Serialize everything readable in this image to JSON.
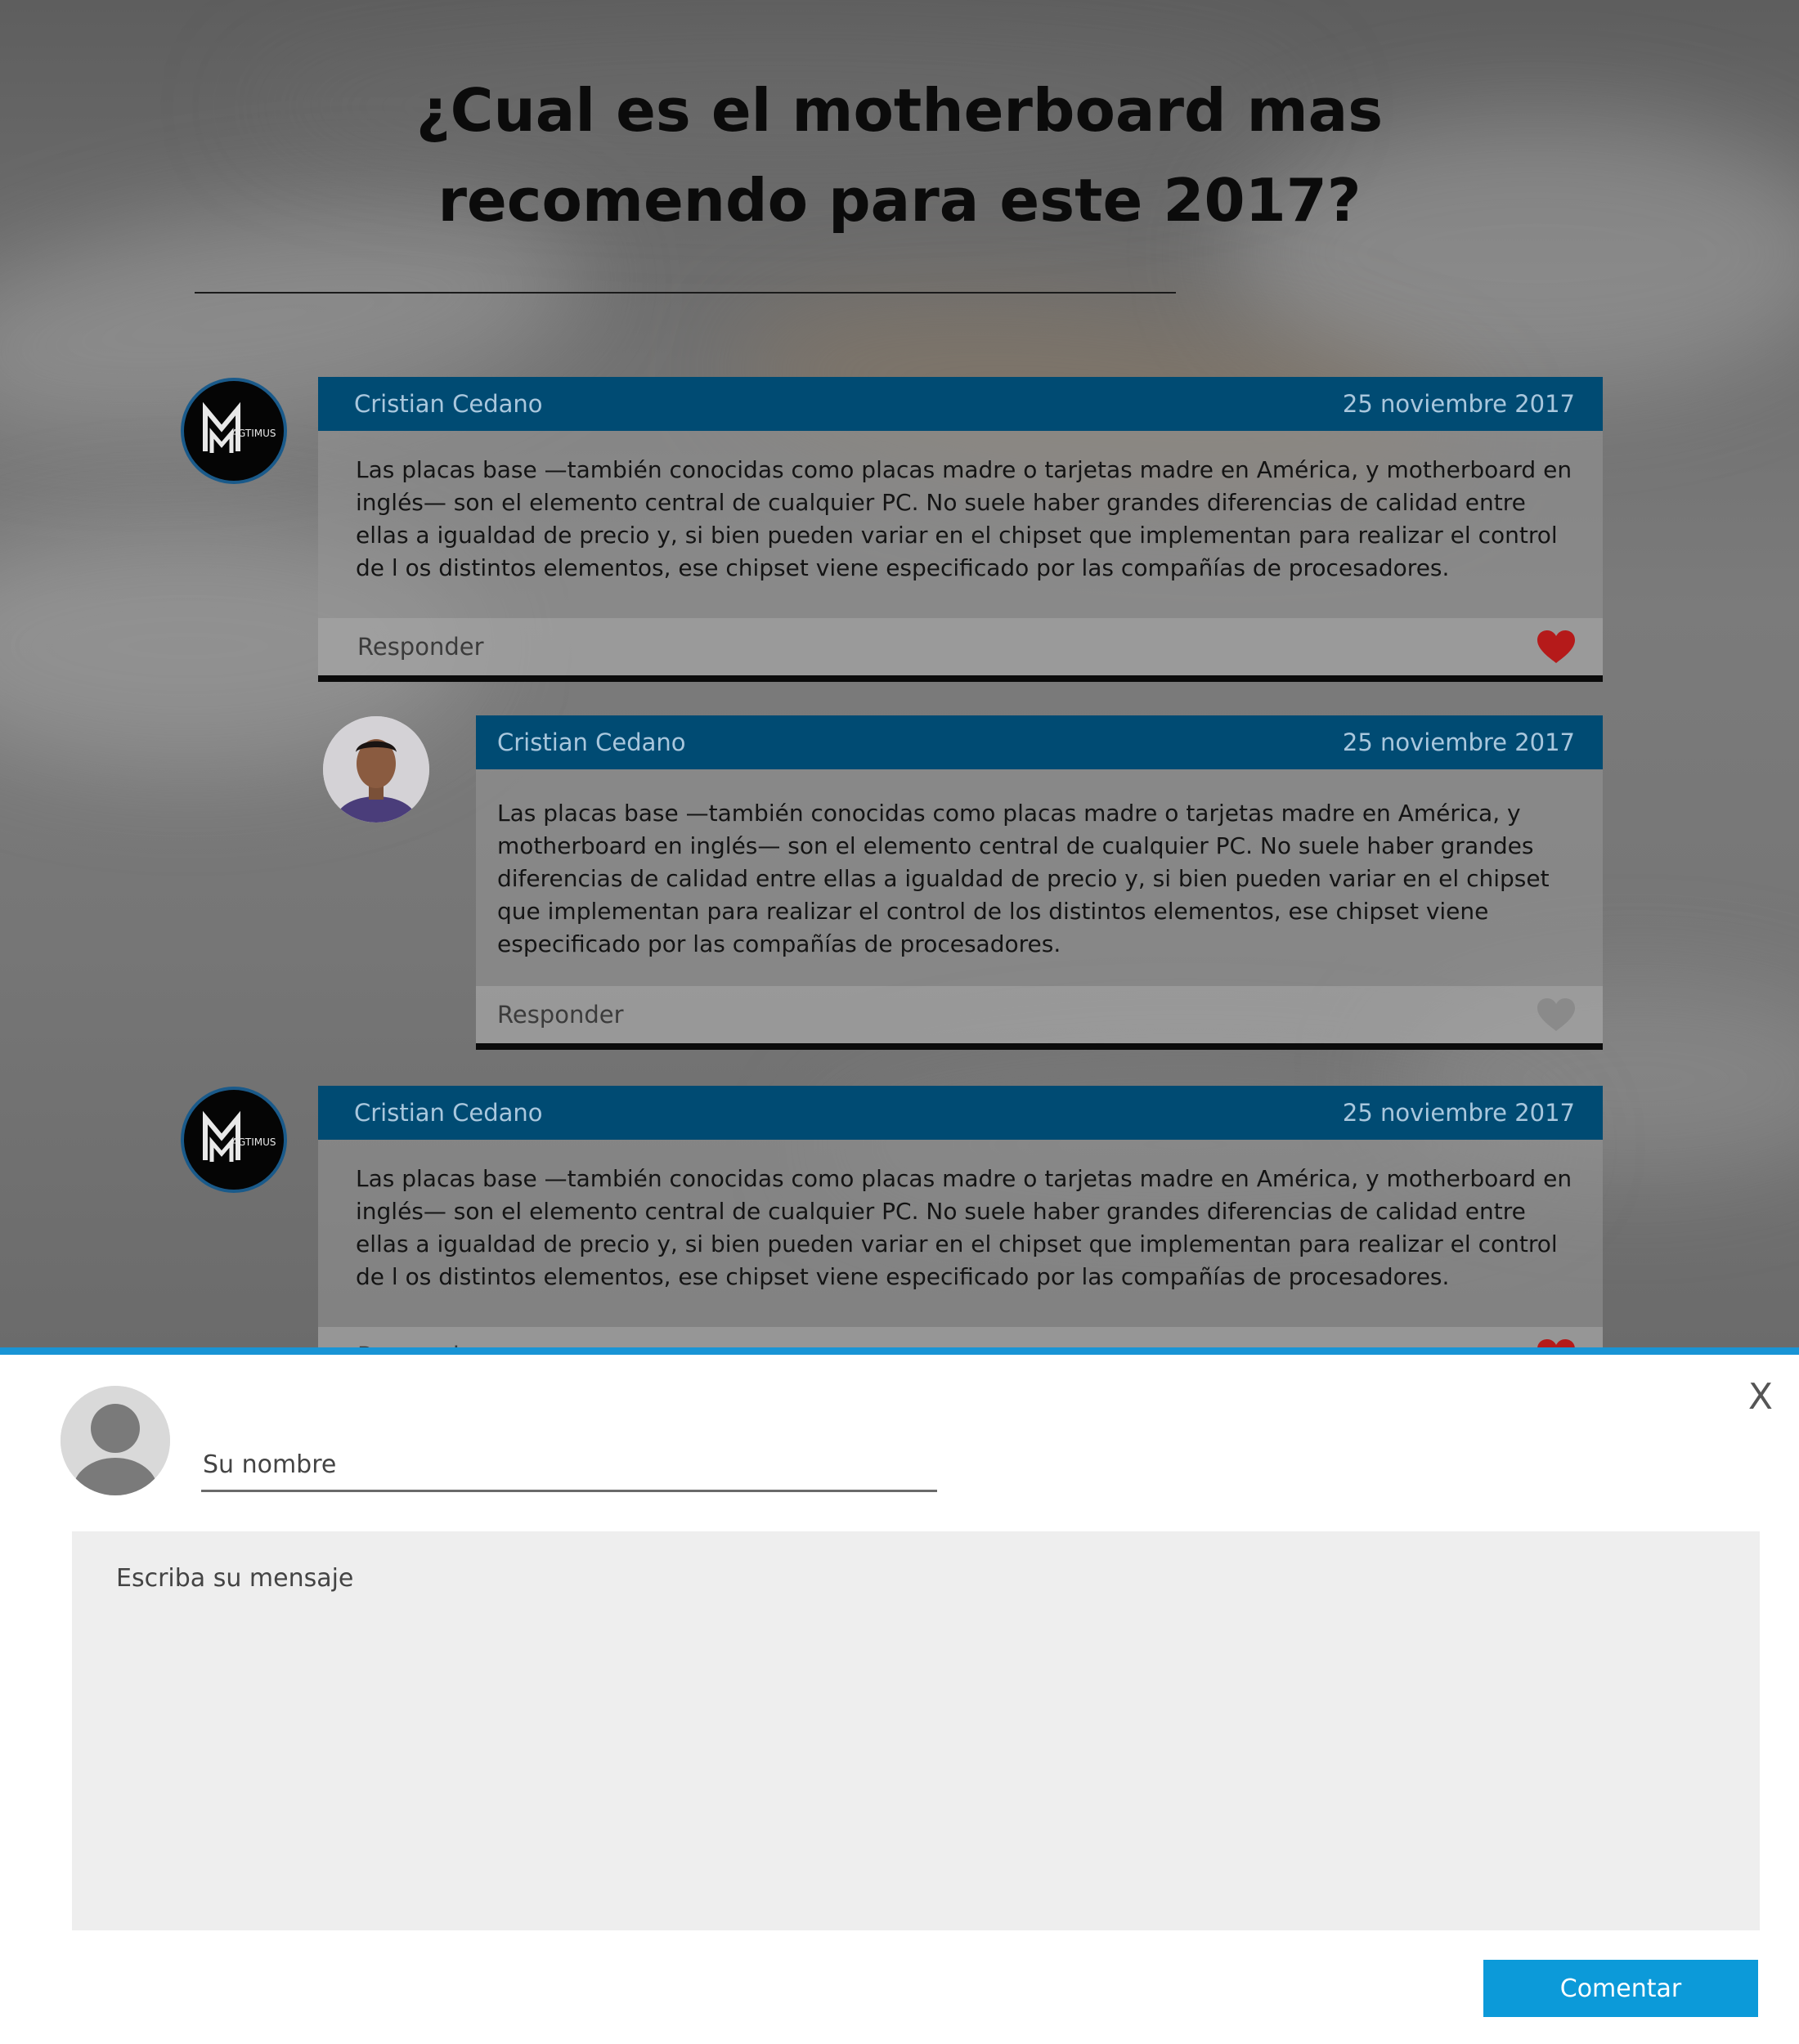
{
  "page": {
    "title": "¿Cual es el motherboard mas recomendo para este 2017?"
  },
  "colors": {
    "header_bg": "#004b73",
    "accent": "#1994d5",
    "button": "#0c9ad9",
    "heart_liked": "#b51a1a",
    "heart_default": "#8a8a8a"
  },
  "comments": [
    {
      "author": "Cristian Cedano",
      "date": "25 noviembre 2017",
      "avatar": "magtimus-logo",
      "avatar_text": "AGTIMUS",
      "text": "Las placas base —también conocidas como placas madre o tarjetas madre en América, y motherboard en inglés— son el elemento central de cualquier PC. No suele haber grandes diferencias de calidad entre ellas a igualdad de precio y, si bien pueden variar en el chipset que implementan para realizar el control de l os distintos elementos, ese chipset viene especificado por las compañías de procesadores.",
      "reply_label": "Responder",
      "liked": true
    },
    {
      "author": "Cristian Cedano",
      "date": "25 noviembre 2017",
      "avatar": "user-photo",
      "text": "Las placas base —también conocidas como placas madre o tarjetas madre en América, y motherboard en inglés— son el elemento central de cualquier PC. No suele haber grandes diferencias de calidad entre ellas a igualdad de precio y, si bien pueden variar en el chipset que implementan para realizar el control de los distintos elementos, ese chipset viene especificado por las compañías de procesadores.",
      "reply_label": "Responder",
      "liked": false
    },
    {
      "author": "Cristian Cedano",
      "date": "25 noviembre 2017",
      "avatar": "magtimus-logo",
      "avatar_text": "AGTIMUS",
      "text": "Las placas base —también conocidas como placas madre o tarjetas madre en América, y motherboard en inglés— son el elemento central de cualquier PC. No suele haber grandes diferencias de calidad entre ellas a igualdad de precio y, si bien pueden variar en el chipset que implementan para realizar el control de l os distintos elementos, ese chipset viene especificado por las compañías de procesadores.",
      "reply_label": "Responder",
      "liked": true
    }
  ],
  "form": {
    "close_label": "X",
    "name_placeholder": "Su nombre",
    "message_placeholder": "Escriba su mensaje",
    "submit_label": "Comentar"
  }
}
